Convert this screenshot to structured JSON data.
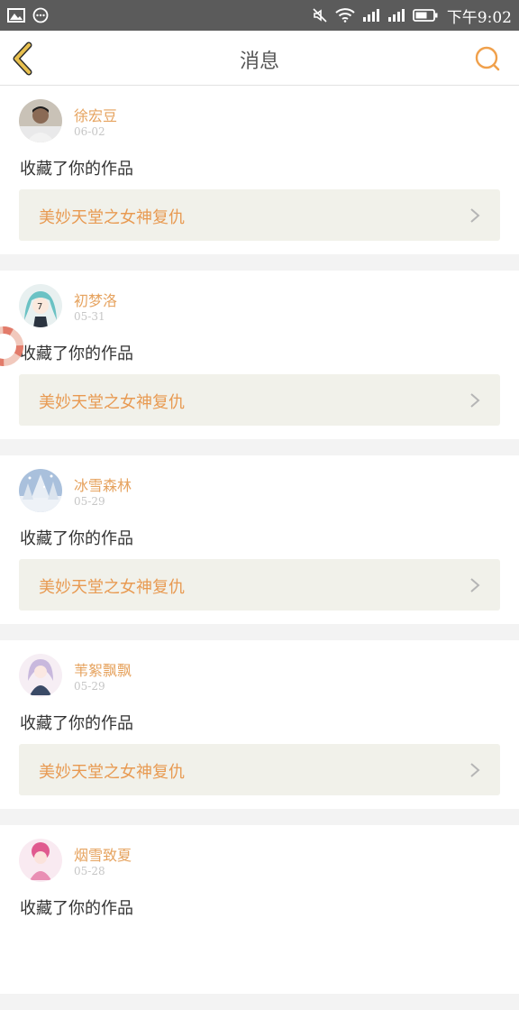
{
  "status_bar": {
    "time": "下午9:02",
    "icons": [
      "image-icon",
      "chat-icon",
      "mute-icon",
      "wifi-icon",
      "signal-icon",
      "signal-icon",
      "battery-icon"
    ]
  },
  "header": {
    "title": "消息",
    "back_icon": "chevron-left-icon",
    "search_icon": "search-icon",
    "accent_color": "#e8b84a"
  },
  "messages": [
    {
      "user": "徐宏豆",
      "date": "06-02",
      "action": "收藏了你的作品",
      "work_title": "美妙天堂之女神复仇",
      "avatar_color": "#8a7a6a"
    },
    {
      "user": "初梦洛",
      "date": "05-31",
      "action": "收藏了你的作品",
      "work_title": "美妙天堂之女神复仇",
      "avatar_color": "#7fc7c9"
    },
    {
      "user": "冰雪森林",
      "date": "05-29",
      "action": "收藏了你的作品",
      "work_title": "美妙天堂之女神复仇",
      "avatar_color": "#9bb6d8"
    },
    {
      "user": "苇絮飘飘",
      "date": "05-29",
      "action": "收藏了你的作品",
      "work_title": "美妙天堂之女神复仇",
      "avatar_color": "#8a6fa6"
    },
    {
      "user": "烟雪致夏",
      "date": "05-28",
      "action": "收藏了你的作品",
      "work_title": "",
      "avatar_color": "#e98fb4"
    }
  ]
}
